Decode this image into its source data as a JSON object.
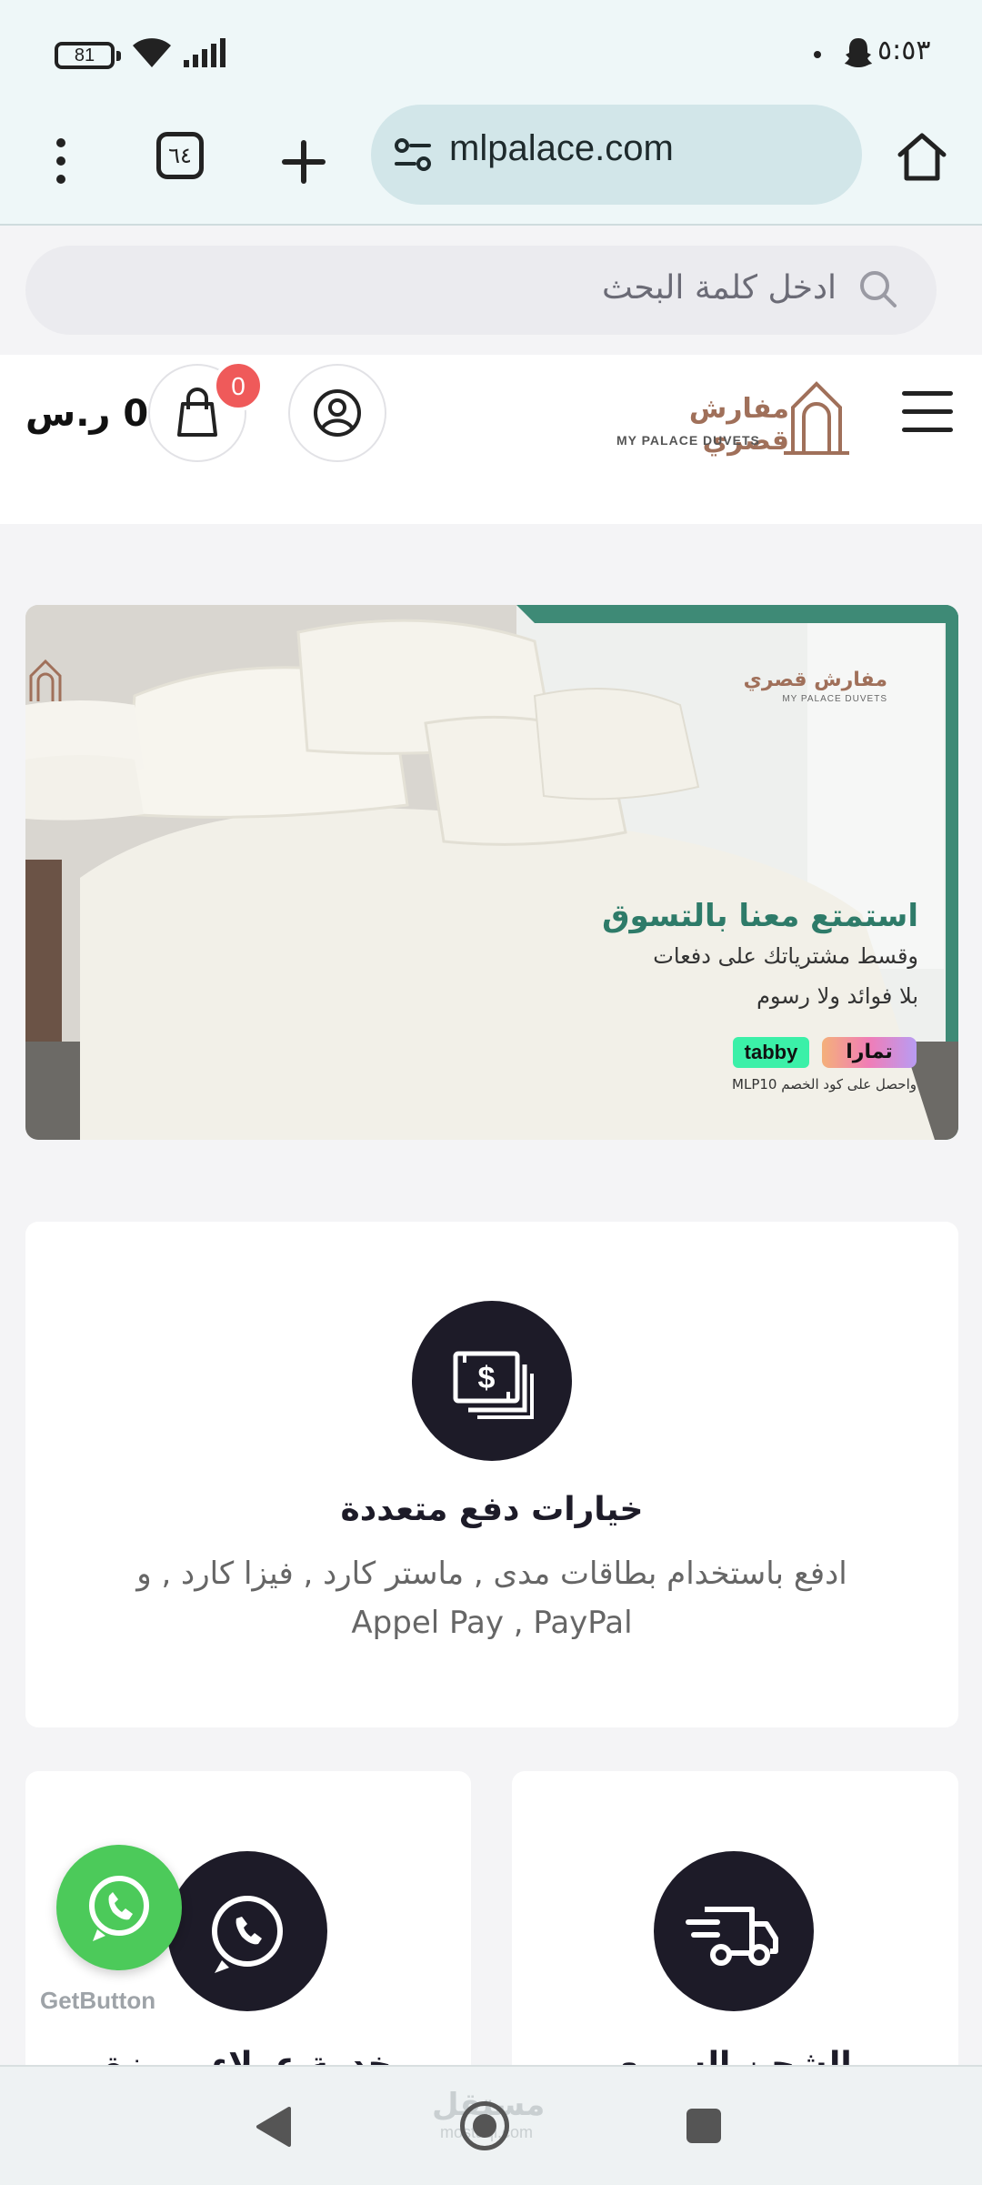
{
  "status_bar": {
    "battery": "81",
    "time": "٥:٥٣"
  },
  "browser": {
    "tab_count": "٦٤",
    "url": "mlpalace.com"
  },
  "search": {
    "placeholder": "ادخل كلمة البحث"
  },
  "header": {
    "cart_total": "0 ر.س",
    "cart_count": "0",
    "logo_ar": "مفارش قصري",
    "logo_en": "MY PALACE DUVETS"
  },
  "banner": {
    "logo_ar": "مفارش قصري",
    "logo_en": "MY PALACE DUVETS",
    "headline": "استمتع معنا بالتسوق",
    "line1": "وقسط مشترياتك على دفعات",
    "line2": "بلا فوائد ولا رسوم",
    "tabby": "tabby",
    "tamara": "تمارا",
    "promo": "واحصل على كود الخصم MLP10"
  },
  "features": {
    "payment": {
      "title": "خيارات دفع متعددة",
      "description": "ادفع باستخدام بطاقات مدى , ماستر كارد , فيزا كارد , و Appel Pay , PayPal"
    },
    "support": {
      "title": "خدمة عملاء مميزة"
    },
    "shipping": {
      "title": "الشحن السريع"
    }
  },
  "floating": {
    "powered_by": "GetButton"
  },
  "navbar": {
    "watermark": "مستقل",
    "watermark_sub": "mostaql.com"
  },
  "colors": {
    "browser_bg": "#eef7f8",
    "url_pill": "#d2e6e9",
    "icon_circle": "#1d1b28",
    "badge": "#ef5a5a",
    "whatsapp": "#4cca5a",
    "brand_gold": "#a0705a",
    "banner_green": "#2e7b69"
  },
  "icons": [
    "wifi-icon",
    "signal-icon",
    "snapchat-icon",
    "more-icon",
    "tabs-icon",
    "plus-icon",
    "site-settings-icon",
    "home-icon",
    "search-icon",
    "cart-icon",
    "user-icon",
    "menu-icon",
    "cash-icon",
    "whatsapp-icon",
    "truck-icon",
    "back-icon",
    "recents-icon"
  ]
}
